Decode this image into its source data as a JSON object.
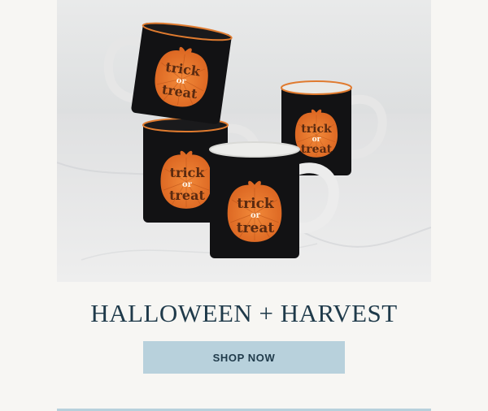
{
  "hero": {
    "mug_text_line1": "trick",
    "mug_text_line2": "or",
    "mug_text_line3": "treat"
  },
  "headline": "HALLOWEEN + HARVEST",
  "cta_label": "SHOP NOW",
  "colors": {
    "page_bg": "#f7f6f3",
    "headline": "#1f3a4a",
    "button_bg": "#b8d1dc",
    "mug_black": "#121214",
    "pumpkin_orange": "#e9782b"
  }
}
